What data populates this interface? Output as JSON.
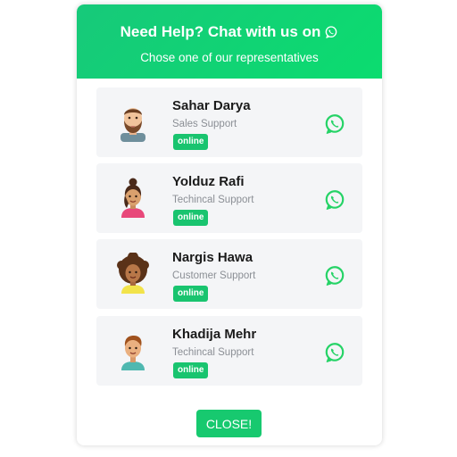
{
  "header": {
    "title": "Need Help? Chat with us on",
    "subtitle": "Chose one of our representatives"
  },
  "agents": [
    {
      "name": "Sahar Darya",
      "role": "Sales Support",
      "status": "online",
      "avatar_icon": "bearded-man-avatar"
    },
    {
      "name": "Yolduz Rafi",
      "role": "Techincal Support",
      "status": "online",
      "avatar_icon": "woman-bun-avatar"
    },
    {
      "name": "Nargis Hawa",
      "role": "Customer Support",
      "status": "online",
      "avatar_icon": "curly-hair-woman-avatar"
    },
    {
      "name": "Khadija Mehr",
      "role": "Techincal Support",
      "status": "online",
      "avatar_icon": "young-man-avatar"
    }
  ],
  "chat_icon": "whatsapp-icon",
  "close_label": "CLOSE!",
  "colors": {
    "accent": "#19c46f",
    "whatsapp": "#25d366",
    "card_bg": "#f4f5f7"
  }
}
